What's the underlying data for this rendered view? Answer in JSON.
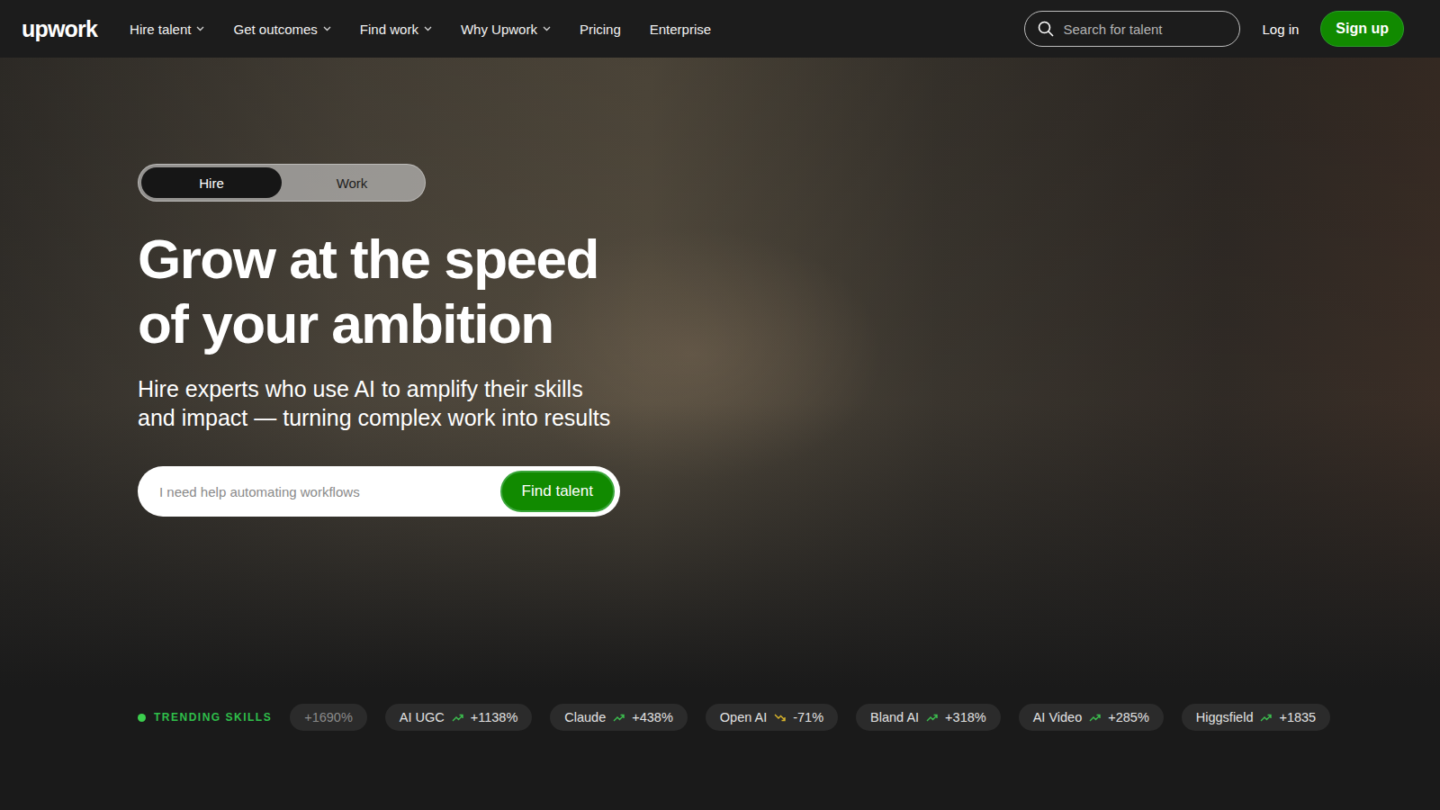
{
  "header": {
    "logo": "upwork",
    "nav": [
      {
        "label": "Hire talent",
        "has_menu": true
      },
      {
        "label": "Get outcomes",
        "has_menu": true
      },
      {
        "label": "Find work",
        "has_menu": true
      },
      {
        "label": "Why Upwork",
        "has_menu": true
      },
      {
        "label": "Pricing",
        "has_menu": false
      },
      {
        "label": "Enterprise",
        "has_menu": false
      }
    ],
    "search": {
      "placeholder": "Search for talent"
    },
    "login": "Log in",
    "signup": "Sign up"
  },
  "hero": {
    "toggle": [
      {
        "label": "Hire",
        "selected": true
      },
      {
        "label": "Work",
        "selected": false
      }
    ],
    "heading": [
      "Grow at the speed",
      "of your ambition"
    ],
    "subheading": [
      "Hire experts who use AI to amplify their skills",
      "and impact — turning complex work into results"
    ],
    "search": {
      "placeholder": "I need help automating workflows",
      "button": "Find talent"
    }
  },
  "trending": {
    "label": "TRENDING SKILLS",
    "skills": [
      {
        "name": "",
        "change": "+1690%",
        "kind": "clipped"
      },
      {
        "name": "AI UGC",
        "change": "+1138%",
        "kind": "up"
      },
      {
        "name": "Claude",
        "change": "+438%",
        "kind": "up"
      },
      {
        "name": "Open AI",
        "change": "-71%",
        "kind": "down"
      },
      {
        "name": "Bland AI",
        "change": "+318%",
        "kind": "up"
      },
      {
        "name": "AI Video",
        "change": "+285%",
        "kind": "up"
      },
      {
        "name": "Higgsfield",
        "change": "+1835",
        "kind": "up"
      }
    ]
  }
}
